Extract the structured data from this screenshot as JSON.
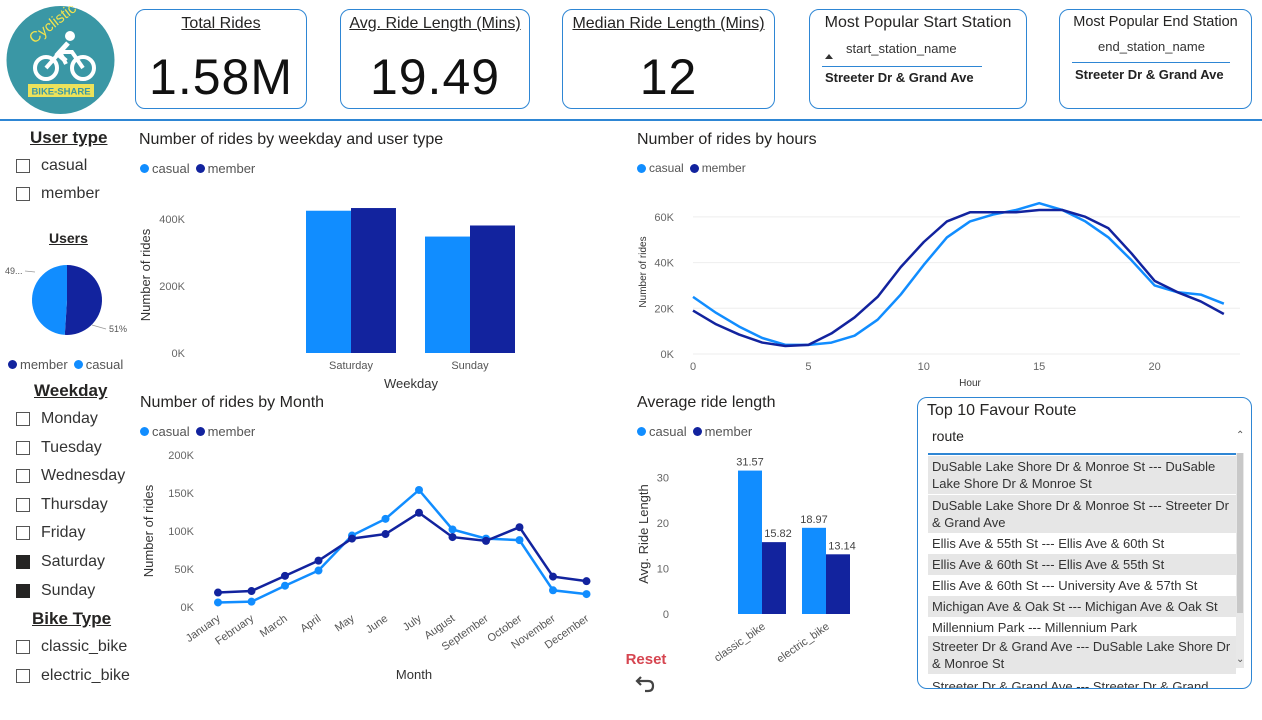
{
  "logo": {
    "text_top": "Cyclistic",
    "text_bottom": "BIKE-SHARE"
  },
  "kpis": [
    {
      "title": "Total Rides",
      "value": "1.58M"
    },
    {
      "title": "Avg. Ride Length (Mins)",
      "value": "19.49"
    },
    {
      "title": "Median Ride Length (Mins)",
      "value": "12"
    }
  ],
  "start_station": {
    "title": "Most Popular Start Station",
    "column": "start_station_name",
    "value": "Streeter Dr & Grand Ave"
  },
  "end_station": {
    "title": "Most Popular End Station",
    "column": "end_station_name",
    "value": "Streeter Dr & Grand Ave"
  },
  "colors": {
    "casual": "#118dff",
    "member": "#12239e",
    "accent": "#2e86d4",
    "reset": "#d64550"
  },
  "slicers": {
    "user_type": {
      "title": "User type",
      "items": [
        {
          "label": "casual",
          "checked": false
        },
        {
          "label": "member",
          "checked": false
        }
      ]
    },
    "weekday": {
      "title": "Weekday",
      "items": [
        {
          "label": "Monday",
          "checked": false
        },
        {
          "label": "Tuesday",
          "checked": false
        },
        {
          "label": "Wednesday",
          "checked": false
        },
        {
          "label": "Thursday",
          "checked": false
        },
        {
          "label": "Friday",
          "checked": false
        },
        {
          "label": "Saturday",
          "checked": true
        },
        {
          "label": "Sunday",
          "checked": true
        }
      ]
    },
    "bike_type": {
      "title": "Bike Type",
      "items": [
        {
          "label": "classic_bike",
          "checked": false
        },
        {
          "label": "electric_bike",
          "checked": false
        }
      ]
    }
  },
  "legend": {
    "casual": "casual",
    "member": "member"
  },
  "reset": {
    "label": "Reset",
    "icon": "undo-arrow-icon"
  },
  "routes": {
    "title": "Top 10 Favour Route",
    "column": "route",
    "rows": [
      "DuSable Lake Shore Dr & Monroe St --- DuSable Lake Shore Dr & Monroe St",
      "DuSable Lake Shore Dr & Monroe St --- Streeter Dr & Grand Ave",
      "Ellis Ave & 55th St --- Ellis Ave & 60th St",
      "Ellis Ave & 60th St --- Ellis Ave & 55th St",
      "Ellis Ave & 60th St --- University Ave & 57th St",
      "Michigan Ave & Oak St --- Michigan Ave & Oak St",
      "Millennium Park --- Millennium Park",
      "Streeter Dr & Grand Ave --- DuSable Lake Shore Dr & Monroe St",
      "Streeter Dr & Grand Ave --- Streeter Dr & Grand"
    ]
  },
  "chart_data": [
    {
      "id": "users_pie",
      "type": "pie",
      "title": "Users",
      "slices": [
        {
          "name": "member",
          "value": 51
        },
        {
          "name": "casual",
          "value": 49
        }
      ],
      "labels": [
        "49...",
        "51%"
      ],
      "legend_position": "bottom"
    },
    {
      "id": "weekday",
      "type": "bar",
      "title": "Number of rides by weekday and user type",
      "categories": [
        "Saturday",
        "Sunday"
      ],
      "series": [
        {
          "name": "casual",
          "values": [
            424000,
            347000
          ]
        },
        {
          "name": "member",
          "values": [
            432000,
            380000
          ]
        }
      ],
      "xlabel": "Weekday",
      "ylabel": "Number of rides",
      "ylim": [
        0,
        450000
      ],
      "yticks": [
        {
          "v": 0,
          "t": "0K"
        },
        {
          "v": 200000,
          "t": "200K"
        },
        {
          "v": 400000,
          "t": "400K"
        }
      ],
      "legend_position": "top-left"
    },
    {
      "id": "hours",
      "type": "line",
      "title": "Number of rides by hours",
      "x": [
        0,
        1,
        2,
        3,
        4,
        5,
        6,
        7,
        8,
        9,
        10,
        11,
        12,
        13,
        14,
        15,
        16,
        17,
        18,
        19,
        20,
        21,
        22,
        23
      ],
      "series": [
        {
          "name": "casual",
          "values": [
            25000,
            18000,
            12000,
            7000,
            4000,
            4000,
            5000,
            8000,
            15000,
            26000,
            39000,
            51000,
            58000,
            61000,
            63000,
            66000,
            63000,
            58000,
            51000,
            41000,
            30000,
            27000,
            26000,
            22000
          ]
        },
        {
          "name": "member",
          "values": [
            19000,
            13000,
            8500,
            5000,
            3500,
            4000,
            9000,
            16000,
            25000,
            38000,
            49000,
            58000,
            62000,
            62000,
            62000,
            63000,
            63000,
            60000,
            55000,
            44000,
            32000,
            27000,
            23000,
            17500
          ]
        }
      ],
      "xlabel": "Hour",
      "ylabel": "Number of rides",
      "xlim": [
        0,
        23.7
      ],
      "ylim": [
        0,
        70000
      ],
      "xticks": [
        0,
        5,
        10,
        15,
        20
      ],
      "yticks": [
        {
          "v": 0,
          "t": "0K"
        },
        {
          "v": 20000,
          "t": "20K"
        },
        {
          "v": 40000,
          "t": "40K"
        },
        {
          "v": 60000,
          "t": "60K"
        }
      ],
      "legend_position": "top-left"
    },
    {
      "id": "month",
      "type": "line",
      "title": "Number of rides by Month",
      "categories": [
        "January",
        "February",
        "March",
        "April",
        "May",
        "June",
        "July",
        "August",
        "September",
        "October",
        "November",
        "December"
      ],
      "series": [
        {
          "name": "casual",
          "values": [
            6000,
            7000,
            28000,
            48000,
            94000,
            116000,
            154000,
            102000,
            90000,
            88000,
            22000,
            17000
          ]
        },
        {
          "name": "member",
          "values": [
            19000,
            21000,
            41000,
            61000,
            90000,
            96000,
            124000,
            92000,
            87000,
            105000,
            40000,
            34000
          ]
        }
      ],
      "xlabel": "Month",
      "ylabel": "Number of rides",
      "ylim": [
        0,
        200000
      ],
      "yticks": [
        {
          "v": 0,
          "t": "0K"
        },
        {
          "v": 50000,
          "t": "50K"
        },
        {
          "v": 100000,
          "t": "100K"
        },
        {
          "v": 150000,
          "t": "150K"
        },
        {
          "v": 200000,
          "t": "200K"
        }
      ],
      "legend_position": "top-left"
    },
    {
      "id": "avg_length",
      "type": "bar",
      "title": "Average ride length",
      "categories": [
        "classic_bike",
        "electric_bike"
      ],
      "series": [
        {
          "name": "casual",
          "values": [
            31.57,
            18.97
          ]
        },
        {
          "name": "member",
          "values": [
            15.82,
            13.14
          ]
        }
      ],
      "data_labels": [
        [
          "31.57",
          "18.97"
        ],
        [
          "15.82",
          "13.14"
        ]
      ],
      "xlabel": "",
      "ylabel": "Avg. Ride Length",
      "ylim": [
        0,
        35
      ],
      "yticks": [
        {
          "v": 0,
          "t": "0"
        },
        {
          "v": 10,
          "t": "10"
        },
        {
          "v": 20,
          "t": "20"
        },
        {
          "v": 30,
          "t": "30"
        }
      ],
      "legend_position": "top-left"
    }
  ]
}
